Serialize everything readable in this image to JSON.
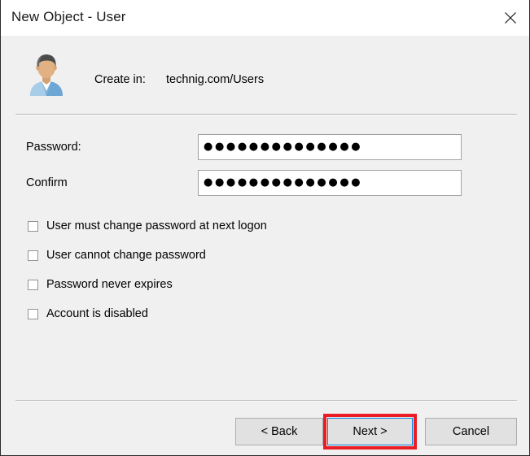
{
  "window": {
    "title": "New Object - User",
    "close_icon": "close-icon"
  },
  "header": {
    "icon": "user-avatar-icon",
    "create_in_label": "Create in:",
    "create_in_value": "technig.com/Users"
  },
  "fields": [
    {
      "label": "Password:",
      "value": "●●●●●●●●●●●●●●",
      "placeholder": ""
    },
    {
      "label": "Confirm",
      "value": "●●●●●●●●●●●●●●",
      "placeholder": ""
    }
  ],
  "checkboxes": [
    {
      "label": "User must change password at next logon",
      "checked": false
    },
    {
      "label": "User cannot change password",
      "checked": false
    },
    {
      "label": "Password never expires",
      "checked": false
    },
    {
      "label": "Account is disabled",
      "checked": false
    }
  ],
  "buttons": {
    "back": "< Back",
    "next": "Next >",
    "cancel": "Cancel"
  },
  "annotation": {
    "highlight_target": "Next >",
    "highlight_color": "#ec1c24"
  },
  "colors": {
    "dialog_background": "#f0f0f0",
    "titlebar_background": "#ffffff",
    "button_face": "#e1e1e1",
    "field_background": "#ffffff",
    "focus_border": "#0078d7",
    "separator": "#b8b8b8"
  }
}
